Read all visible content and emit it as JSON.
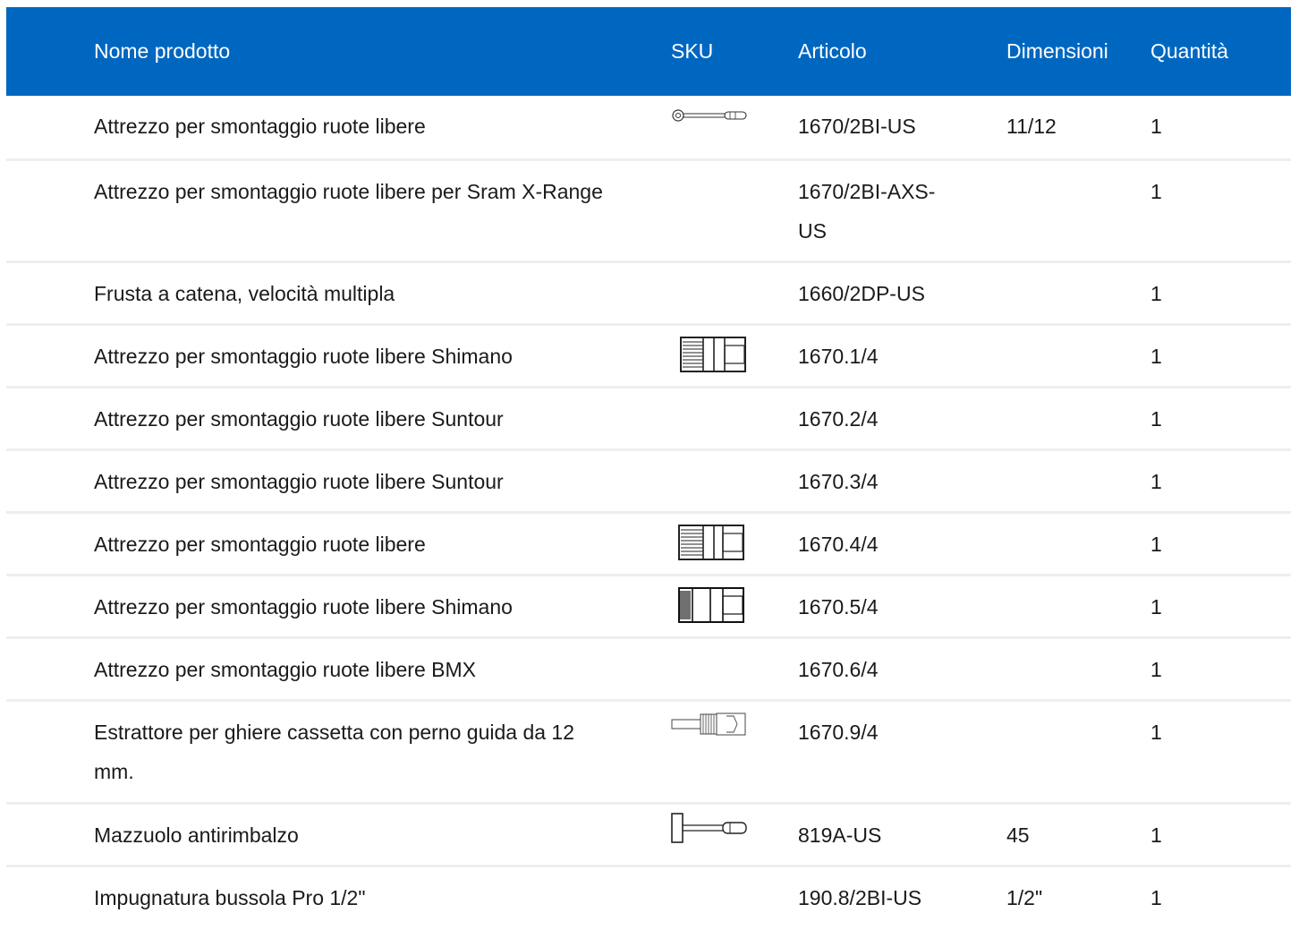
{
  "table": {
    "headers": {
      "name": "Nome prodotto",
      "sku": "SKU",
      "article": "Articolo",
      "dimensions": "Dimensioni",
      "quantity": "Quantità"
    },
    "rows": [
      {
        "name": "Attrezzo per smontaggio ruote libere",
        "sku_icon": "ratchet-wrench-icon",
        "article": "1670/2BI-US",
        "dimensions": "11/12",
        "quantity": "1"
      },
      {
        "name": "Attrezzo per smontaggio ruote libere per Sram X-Range",
        "sku_icon": "",
        "article": "1670/2BI-AXS-US",
        "dimensions": "",
        "quantity": "1"
      },
      {
        "name": "Frusta a catena, velocità multipla",
        "sku_icon": "",
        "article": "1660/2DP-US",
        "dimensions": "",
        "quantity": "1"
      },
      {
        "name": "Attrezzo per smontaggio ruote libere Shimano",
        "sku_icon": "splined-socket-icon",
        "article": "1670.1/4",
        "dimensions": "",
        "quantity": "1"
      },
      {
        "name": "Attrezzo per smontaggio ruote libere Suntour",
        "sku_icon": "",
        "article": "1670.2/4",
        "dimensions": "",
        "quantity": "1"
      },
      {
        "name": "Attrezzo per smontaggio ruote libere Suntour",
        "sku_icon": "",
        "article": "1670.3/4",
        "dimensions": "",
        "quantity": "1"
      },
      {
        "name": "Attrezzo per smontaggio ruote libere",
        "sku_icon": "splined-socket-icon",
        "article": "1670.4/4",
        "dimensions": "",
        "quantity": "1"
      },
      {
        "name": "Attrezzo per smontaggio ruote libere Shimano",
        "sku_icon": "splined-socket-dark-icon",
        "article": "1670.5/4",
        "dimensions": "",
        "quantity": "1"
      },
      {
        "name": "Attrezzo per smontaggio ruote libere BMX",
        "sku_icon": "",
        "article": "1670.6/4",
        "dimensions": "",
        "quantity": "1"
      },
      {
        "name": "Estrattore per ghiere cassetta con perno guida da 12 mm.",
        "sku_icon": "guide-pin-extractor-icon",
        "article": "1670.9/4",
        "dimensions": "",
        "quantity": "1"
      },
      {
        "name": "Mazzuolo antirimbalzo",
        "sku_icon": "mallet-icon",
        "article": "819A-US",
        "dimensions": "45",
        "quantity": "1"
      },
      {
        "name": "Impugnatura bussola Pro 1/2\"",
        "sku_icon": "",
        "article": "190.8/2BI-US",
        "dimensions": "1/2\"",
        "quantity": "1"
      }
    ]
  },
  "colors": {
    "header_bg": "#0067c0",
    "header_text": "#ffffff",
    "row_divider": "#eeeeee"
  }
}
